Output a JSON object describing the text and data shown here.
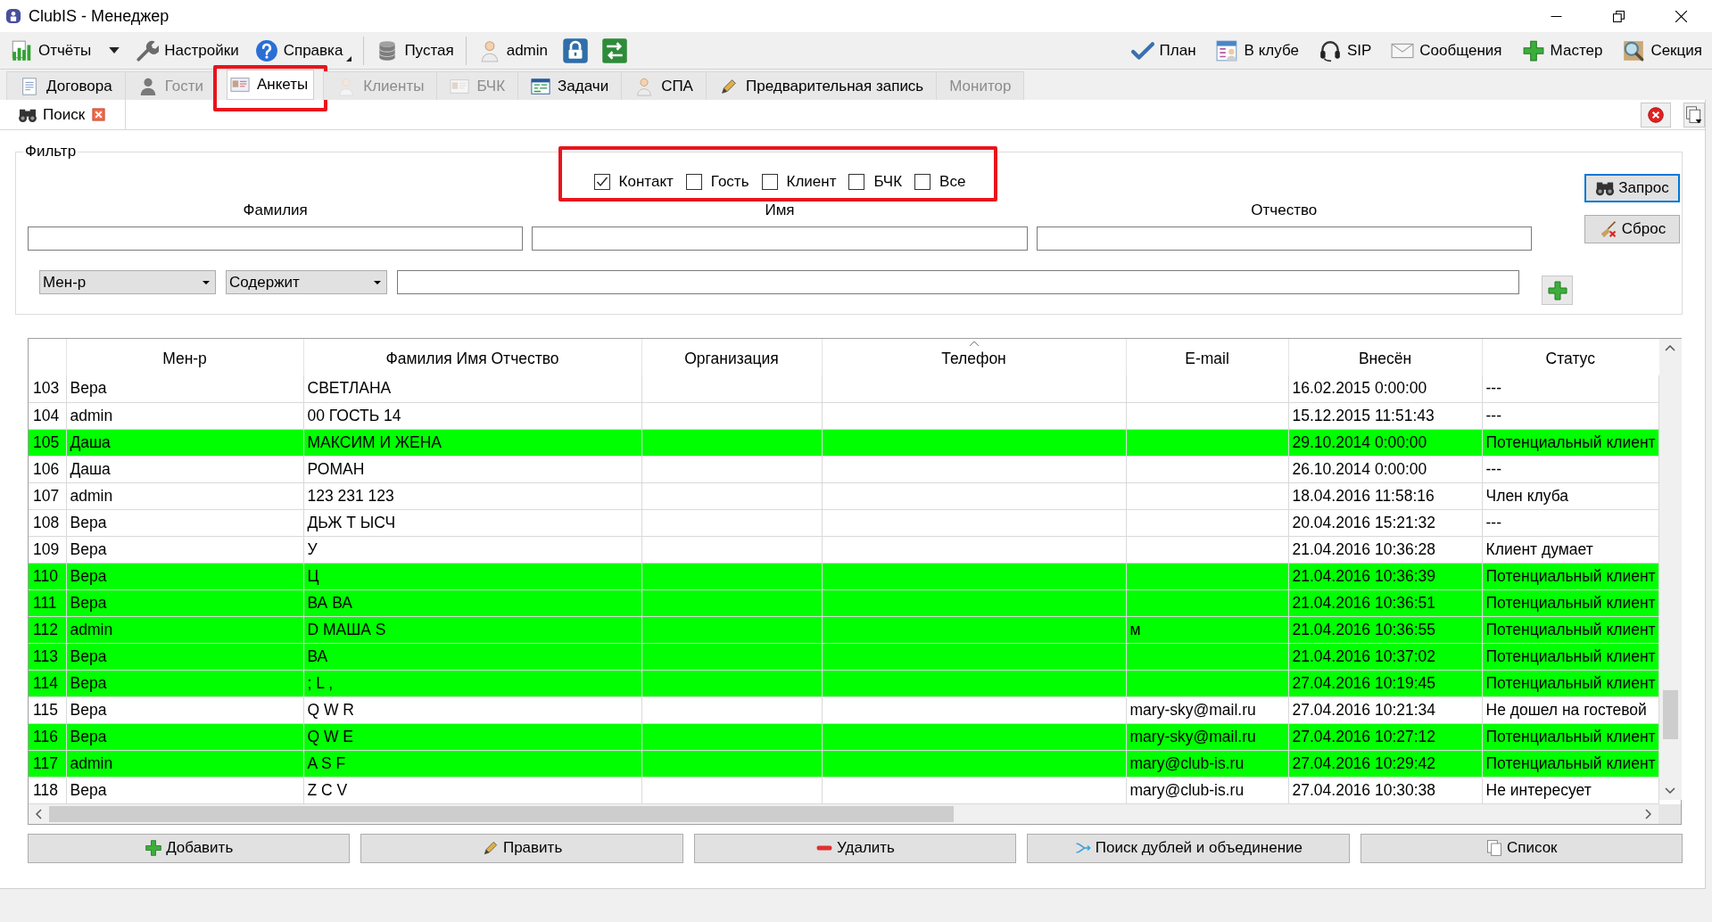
{
  "window": {
    "title": "ClubIS - Менеджер"
  },
  "toolbar": {
    "groups": [
      [
        {
          "label": "Отчёты",
          "kind": "dropdown"
        },
        {
          "label": "Настройки",
          "kind": "button"
        },
        {
          "label": "Справка",
          "kind": "menu"
        }
      ],
      [
        {
          "label": "Пустая",
          "kind": "button"
        }
      ],
      [
        {
          "label": "admin",
          "kind": "button"
        }
      ]
    ],
    "right": [
      {
        "label": "План"
      },
      {
        "label": "В клубе"
      },
      {
        "label": "SIP"
      },
      {
        "label": "Сообщения"
      },
      {
        "label": "Мастер"
      },
      {
        "label": "Секция"
      }
    ]
  },
  "tabs": [
    {
      "label": "Договора",
      "selected": false,
      "disabled": false,
      "outlined": false
    },
    {
      "label": "Гости",
      "selected": false,
      "disabled": true,
      "outlined": false
    },
    {
      "label": "Анкеты",
      "selected": true,
      "disabled": false,
      "outlined": true
    },
    {
      "label": "Клиенты",
      "selected": false,
      "disabled": true,
      "outlined": false
    },
    {
      "label": "БЧК",
      "selected": false,
      "disabled": true,
      "outlined": false
    },
    {
      "label": "Задачи",
      "selected": false,
      "disabled": false,
      "outlined": false
    },
    {
      "label": "СПА",
      "selected": false,
      "disabled": false,
      "outlined": false
    },
    {
      "label": "Предварительная запись",
      "selected": false,
      "disabled": false,
      "outlined": false
    },
    {
      "label": "Монитор",
      "selected": false,
      "disabled": true,
      "outlined": false
    }
  ],
  "subtab": {
    "label": "Поиск"
  },
  "filter": {
    "legend": "Фильтр",
    "outlined": true,
    "checkboxes": [
      {
        "label": "Контакт",
        "checked": true
      },
      {
        "label": "Гость",
        "checked": false
      },
      {
        "label": "Клиент",
        "checked": false
      },
      {
        "label": "БЧК",
        "checked": false
      },
      {
        "label": "Все",
        "checked": false
      }
    ],
    "fields": [
      {
        "label": "Фамилия"
      },
      {
        "label": "Имя"
      },
      {
        "label": "Отчество"
      }
    ],
    "condition": {
      "field": "Мен-р",
      "operator": "Содержит"
    },
    "buttons": [
      {
        "label": "Запрос",
        "focused": true
      },
      {
        "label": "Сброс",
        "focused": false
      }
    ]
  },
  "table": {
    "columns": [
      {
        "label": "Мен-р",
        "sorted": false
      },
      {
        "label": "Фамилия Имя Отчество",
        "sorted": false
      },
      {
        "label": "Организация",
        "sorted": false
      },
      {
        "label": "Телефон",
        "sorted": true
      },
      {
        "label": "E-mail",
        "sorted": false
      },
      {
        "label": "Внесён",
        "sorted": false
      },
      {
        "label": "Статус",
        "sorted": false
      }
    ],
    "rows": [
      {
        "number": "103",
        "manager": "Вера",
        "full_name": "СВЕТЛАНА",
        "added": "16.02.2015 0:00:00",
        "status": "---",
        "highlighted": false
      },
      {
        "number": "104",
        "manager": "admin",
        "full_name": "00 ГОСТЬ 14",
        "added": "15.12.2015 11:51:43",
        "status": "---",
        "highlighted": false
      },
      {
        "number": "105",
        "manager": "Даша",
        "full_name": "МАКСИМ И ЖЕНА",
        "added": "29.10.2014 0:00:00",
        "status": "Потенциальный клиент",
        "highlighted": true
      },
      {
        "number": "106",
        "manager": "Даша",
        "full_name": "РОМАН",
        "added": "26.10.2014 0:00:00",
        "status": "---",
        "highlighted": false
      },
      {
        "number": "107",
        "manager": "admin",
        "full_name": "123 231 123",
        "added": "18.04.2016 11:58:16",
        "status": "Член клуба",
        "highlighted": false
      },
      {
        "number": "108",
        "manager": "Вера",
        "full_name": "ДЬЖ Т ЫСЧ",
        "added": "20.04.2016 15:21:32",
        "status": "---",
        "highlighted": false
      },
      {
        "number": "109",
        "manager": "Вера",
        "full_name": "У",
        "added": "21.04.2016 10:36:28",
        "status": "Клиент думает",
        "highlighted": false
      },
      {
        "number": "110",
        "manager": "Вера",
        "full_name": "Ц",
        "added": "21.04.2016 10:36:39",
        "status": "Потенциальный клиент",
        "highlighted": true
      },
      {
        "number": "111",
        "manager": "Вера",
        "full_name": "ВА ВА",
        "added": "21.04.2016 10:36:51",
        "status": "Потенциальный клиент",
        "highlighted": true
      },
      {
        "number": "112",
        "manager": "admin",
        "full_name": "D МАША S",
        "email": "м",
        "added": "21.04.2016 10:36:55",
        "status": "Потенциальный клиент",
        "highlighted": true
      },
      {
        "number": "113",
        "manager": "Вера",
        "full_name": "ВА",
        "added": "21.04.2016 10:37:02",
        "status": "Потенциальный клиент",
        "highlighted": true
      },
      {
        "number": "114",
        "manager": "Вера",
        "full_name": "; L ,",
        "added": "27.04.2016 10:19:45",
        "status": "Потенциальный клиент",
        "highlighted": true
      },
      {
        "number": "115",
        "manager": "Вера",
        "full_name": "Q W R",
        "email": "mary-sky@mail.ru",
        "added": "27.04.2016 10:21:34",
        "status": "Не дошел на гостевой",
        "highlighted": false
      },
      {
        "number": "116",
        "manager": "Вера",
        "full_name": "Q W E",
        "email": "mary-sky@mail.ru",
        "added": "27.04.2016 10:27:12",
        "status": "Потенциальный клиент",
        "highlighted": true
      },
      {
        "number": "117",
        "manager": "admin",
        "full_name": "A S F",
        "email": "mary@club-is.ru",
        "added": "27.04.2016 10:29:42",
        "status": "Потенциальный клиент",
        "highlighted": true
      },
      {
        "number": "118",
        "manager": "Вера",
        "full_name": "Z C V",
        "email": "mary@club-is.ru",
        "added": "27.04.2016 10:30:38",
        "status": "Не интересует",
        "highlighted": false
      }
    ]
  },
  "actions": [
    {
      "label": "Добавить"
    },
    {
      "label": "Править"
    },
    {
      "label": "Удалить"
    },
    {
      "label": "Поиск дублей и объединение"
    },
    {
      "label": "Список"
    }
  ]
}
